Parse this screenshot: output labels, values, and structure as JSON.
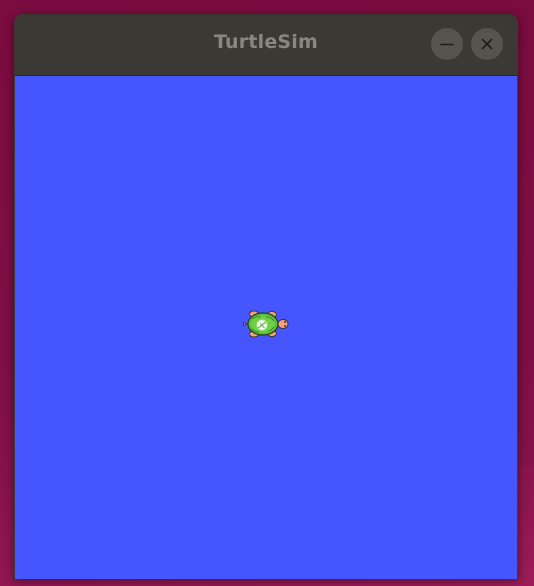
{
  "window": {
    "title": "TurtleSim",
    "buttons": {
      "minimize_icon": "minimize-icon",
      "close_icon": "close-icon"
    }
  },
  "canvas": {
    "background_color": "#4556ff",
    "turtle": {
      "icon": "turtle-icon",
      "shell_color": "#5bbf3a",
      "heading": "east"
    }
  },
  "colors": {
    "titlebar": "#3c3935",
    "title_text": "#8a8783",
    "desktop": "#7a0c3f"
  }
}
